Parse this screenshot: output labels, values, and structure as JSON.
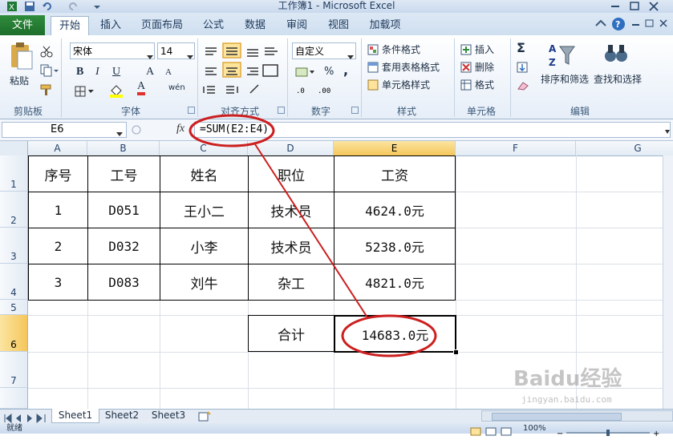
{
  "window": {
    "title": "工作簿1 - Microsoft Excel"
  },
  "tabs": {
    "file": "文件",
    "items": [
      "开始",
      "插入",
      "页面布局",
      "公式",
      "数据",
      "审阅",
      "视图",
      "加载项"
    ]
  },
  "ribbon": {
    "clipboard": {
      "paste": "粘贴",
      "label": "剪贴板"
    },
    "font": {
      "name": "宋体",
      "size": "14",
      "bold": "B",
      "italic": "I",
      "underline": "U",
      "grow": "A",
      "shrink": "A",
      "font_color": "A",
      "wen": "wén",
      "label": "字体"
    },
    "alignment": {
      "label": "对齐方式"
    },
    "number": {
      "format": "自定义",
      "label": "数字",
      "percent": "%",
      "comma": ","
    },
    "styles": {
      "conditional": "条件格式",
      "table": "套用表格格式",
      "cell": "单元格样式",
      "label": "样式"
    },
    "cells": {
      "insert": "插入",
      "delete": "删除",
      "format": "格式",
      "label": "单元格"
    },
    "editing": {
      "sum": "Σ",
      "sort": "排序和筛选",
      "find": "查找和选择",
      "label": "编辑"
    }
  },
  "formula_bar": {
    "name_box": "E6",
    "fx": "fx",
    "formula": "=SUM(E2:E4)"
  },
  "columns": [
    "A",
    "B",
    "C",
    "D",
    "E",
    "F",
    "G"
  ],
  "rows": [
    "1",
    "2",
    "3",
    "4",
    "5",
    "6",
    "7"
  ],
  "table": {
    "headers": [
      "序号",
      "工号",
      "姓名",
      "职位",
      "工资"
    ],
    "data": [
      [
        "1",
        "D051",
        "王小二",
        "技术员",
        "4624.0元"
      ],
      [
        "2",
        "D032",
        "小李",
        "技术员",
        "5238.0元"
      ],
      [
        "3",
        "D083",
        "刘牛",
        "杂工",
        "4821.0元"
      ]
    ],
    "total_label": "合计",
    "total_value": "14683.0元"
  },
  "sheets": [
    "Sheet1",
    "Sheet2",
    "Sheet3"
  ],
  "status": {
    "ready": "就绪",
    "zoom": "100%"
  },
  "watermark": {
    "brand": "Baidu经验",
    "url": "jingyan.baidu.com"
  },
  "colors": {
    "annotation": "#cc1f1f",
    "selected_header": "#f5c65b",
    "file_tab": "#1d6e2b"
  }
}
